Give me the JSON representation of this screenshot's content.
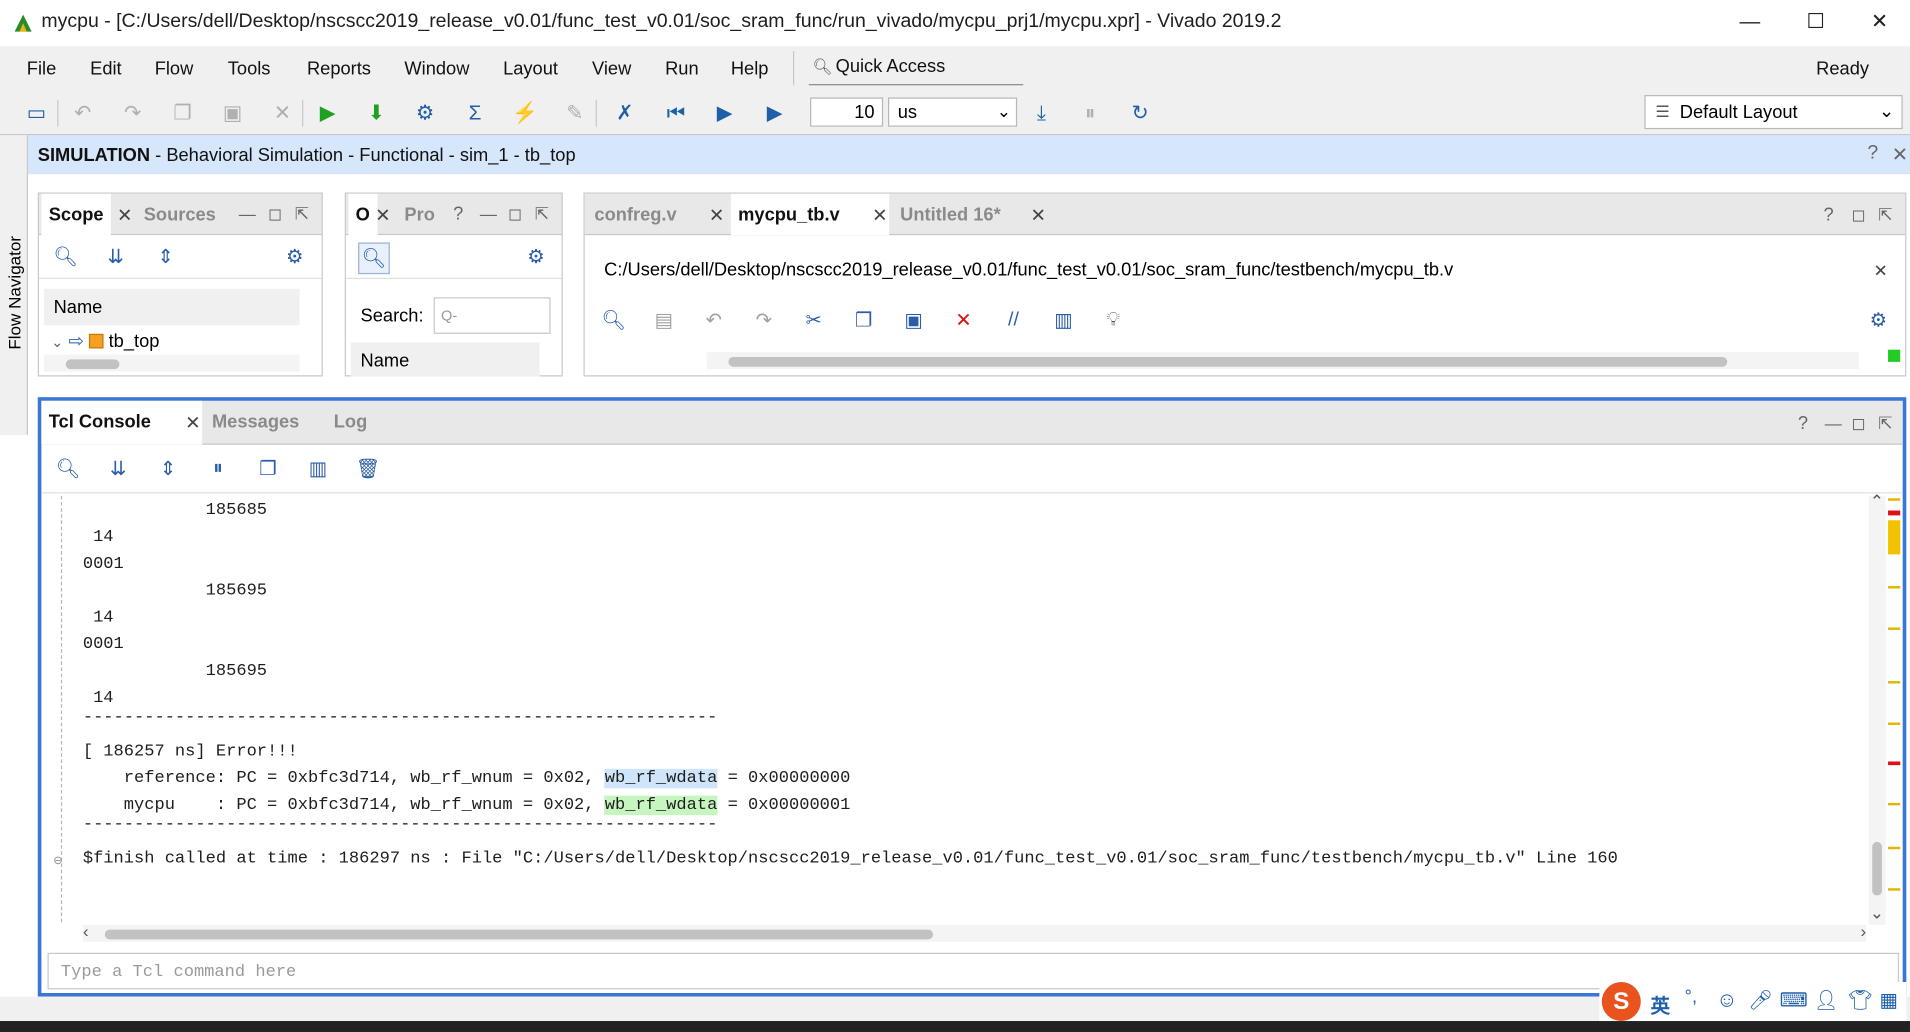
{
  "window": {
    "app_name": "mycpu",
    "title": "mycpu - [C:/Users/dell/Desktop/nscscc2019_release_v0.01/func_test_v0.01/soc_sram_func/run_vivado/mycpu_prj1/mycpu.xpr] - Vivado 2019.2"
  },
  "menu": {
    "items": [
      "File",
      "Edit",
      "Flow",
      "Tools",
      "Reports",
      "Window",
      "Layout",
      "View",
      "Run",
      "Help"
    ],
    "quick_access": "Quick Access",
    "status": "Ready"
  },
  "toolbar": {
    "run_time_value": "10",
    "run_time_unit": "us",
    "layout": "Default Layout"
  },
  "flow_navigator": {
    "label": "Flow Navigator"
  },
  "sim_header": {
    "mode": "SIMULATION",
    "description": " - Behavioral Simulation - Functional - sim_1 - tb_top"
  },
  "scope_panel": {
    "tabs": [
      "Scope",
      "Sources"
    ],
    "column": "Name",
    "tree_item": "tb_top"
  },
  "objects_panel": {
    "tabs": [
      "O",
      "Pro"
    ],
    "search_label": "Search:",
    "search_placeholder": "Q-",
    "column": "Name"
  },
  "editor_panel": {
    "tabs": [
      "confreg.v",
      "mycpu_tb.v",
      "Untitled 16*"
    ],
    "file_path": "C:/Users/dell/Desktop/nscscc2019_release_v0.01/func_test_v0.01/soc_sram_func/testbench/mycpu_tb.v"
  },
  "console": {
    "tabs": [
      "Tcl Console",
      "Messages",
      "Log"
    ],
    "lines": [
      "            185685",
      " 14",
      "0001",
      "            185695",
      " 14",
      "0001",
      "            185695",
      " 14",
      "--------------------------------------------------------------",
      "[ 186257 ns] Error!!!",
      "    reference: PC = 0xbfc3d714, wb_rf_wnum = 0x02, ",
      "    mycpu    : PC = 0xbfc3d714, wb_rf_wnum = 0x02, ",
      "--------------------------------------------------------------",
      "$finish called at time : 186297 ns : File \"C:/Users/dell/Desktop/nscscc2019_release_v0.01/func_test_v0.01/soc_sram_func/testbench/mycpu_tb.v\" Line 160"
    ],
    "highlight_word": "wb_rf_wdata",
    "ref_value": " = 0x00000000",
    "mycpu_value": " = 0x00000001",
    "command_placeholder": "Type a Tcl command here"
  },
  "ime": {
    "lang": "英",
    "punct": "°,"
  }
}
